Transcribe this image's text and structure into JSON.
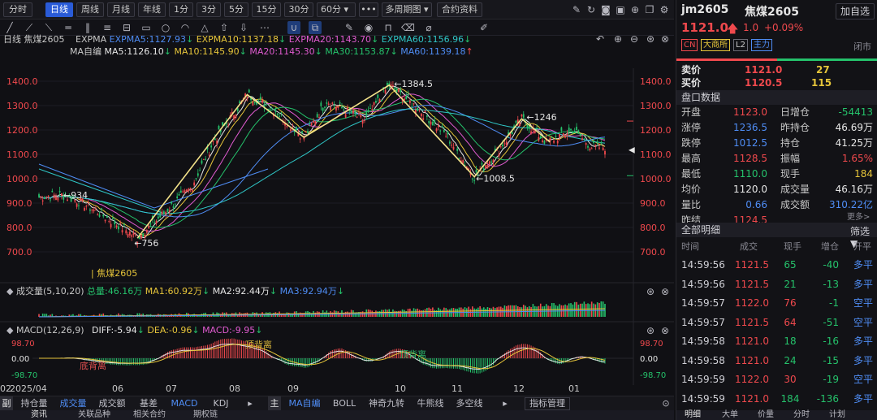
{
  "toolbar": {
    "periods": [
      "分时",
      "日线",
      "周线",
      "月线",
      "年线",
      "1分",
      "3分",
      "5分",
      "15分",
      "30分",
      "60分"
    ],
    "active": "日线",
    "more": "•••",
    "multi_period": "多周期图",
    "contract_info": "合约资料"
  },
  "legend": {
    "period": "日线",
    "name": "焦煤2605",
    "expma": "EXPMA",
    "expma5": "EXPMA5:1127.93",
    "expma10": "EXPMA10:1137.18",
    "expma20": "EXPMA20:1143.70",
    "expma60": "EXPMA60:1156.96",
    "ma_label": "MA自编",
    "ma5": "MA5:1126.10",
    "ma10": "MA10:1145.90",
    "ma20": "MA20:1145.30",
    "ma30": "MA30:1153.87",
    "ma60": "MA60:1139.18"
  },
  "price_axis": [
    "1400.0",
    "1300.0",
    "1200.0",
    "1100.0",
    "1000.0",
    "900.0",
    "800.0",
    "700.0"
  ],
  "annotations": {
    "high": "1384.5",
    "low": "756",
    "mid_left": "934",
    "mid_right": "1246",
    "bottom_right": "1008.5",
    "contract_mark": "焦煤2605"
  },
  "volume_legend": {
    "title": "成交量(5,10,20)",
    "total": "总量:46.16万",
    "ma1": "MA1:60.92万",
    "ma2": "MA2:92.44万",
    "ma3": "MA3:92.94万"
  },
  "macd_legend": {
    "title": "MACD(12,26,9)",
    "diff": "DIFF:-5.94",
    "dea": "DEA:-0.96",
    "macd": "MACD:-9.95"
  },
  "macd_axis": {
    "top": "98.70",
    "mid": "0.00",
    "bottom": "-98.70"
  },
  "macd_notes": {
    "a": "顶背离",
    "b": "底背离",
    "c": "顶背离"
  },
  "x_axis": [
    "2025/04",
    "06",
    "07",
    "08",
    "09",
    "10",
    "11",
    "12",
    "01",
    "02"
  ],
  "sub_tabs": [
    "副",
    "持仓量",
    "成交量",
    "成交额",
    "基差",
    "MACD",
    "KDJ"
  ],
  "main_tabs": [
    "主",
    "MA自编",
    "BOLL",
    "神奇九转",
    "牛熊线",
    "多空线"
  ],
  "indicator_mgmt": "指标管理",
  "bottom_labels": [
    "资讯",
    "关联品种",
    "相关合约",
    "期权链"
  ],
  "right": {
    "symbol": "jm2605",
    "name": "焦煤2605",
    "add_watch": "加自选",
    "price": "1121.0",
    "change": "1.0",
    "pct": "+0.09%",
    "tags": [
      "CN",
      "大商所",
      "L2",
      "主力"
    ],
    "status": "闭市",
    "ask_label": "卖价",
    "ask_price": "1121.0",
    "ask_vol": "27",
    "bid_label": "买价",
    "bid_price": "1120.5",
    "bid_vol": "115",
    "panel_title": "盘口数据",
    "stats": [
      [
        "开盘",
        "1123.0",
        "日增仓",
        "-54413"
      ],
      [
        "涨停",
        "1236.5",
        "昨持仓",
        "46.69万"
      ],
      [
        "跌停",
        "1012.5",
        "持仓",
        "41.25万"
      ],
      [
        "最高",
        "1128.5",
        "振幅",
        "1.65%"
      ],
      [
        "最低",
        "1110.0",
        "现手",
        "184"
      ],
      [
        "均价",
        "1120.0",
        "成交量",
        "46.16万"
      ],
      [
        "量比",
        "0.66",
        "成交额",
        "310.22亿"
      ],
      [
        "昨结",
        "1124.5",
        "",
        ""
      ]
    ],
    "more": "更多>",
    "detail_title": "全部明细",
    "filter": "筛选",
    "detail_headers": [
      "时间",
      "成交",
      "现手",
      "增仓",
      "开平"
    ],
    "trades": [
      [
        "14:59:56",
        "1121.5",
        "65",
        "-40",
        "多平"
      ],
      [
        "14:59:56",
        "1121.5",
        "21",
        "-13",
        "多平"
      ],
      [
        "14:59:57",
        "1122.0",
        "76",
        "-1",
        "空平"
      ],
      [
        "14:59:57",
        "1121.5",
        "64",
        "-51",
        "空平"
      ],
      [
        "14:59:58",
        "1121.0",
        "18",
        "-16",
        "多平"
      ],
      [
        "14:59:58",
        "1121.0",
        "24",
        "-15",
        "多平"
      ],
      [
        "14:59:59",
        "1122.0",
        "30",
        "-19",
        "空平"
      ],
      [
        "14:59:59",
        "1121.0",
        "184",
        "-136",
        "多平"
      ]
    ],
    "bottom_tabs": [
      "明细",
      "大单",
      "价量",
      "分时",
      "计划"
    ]
  }
}
